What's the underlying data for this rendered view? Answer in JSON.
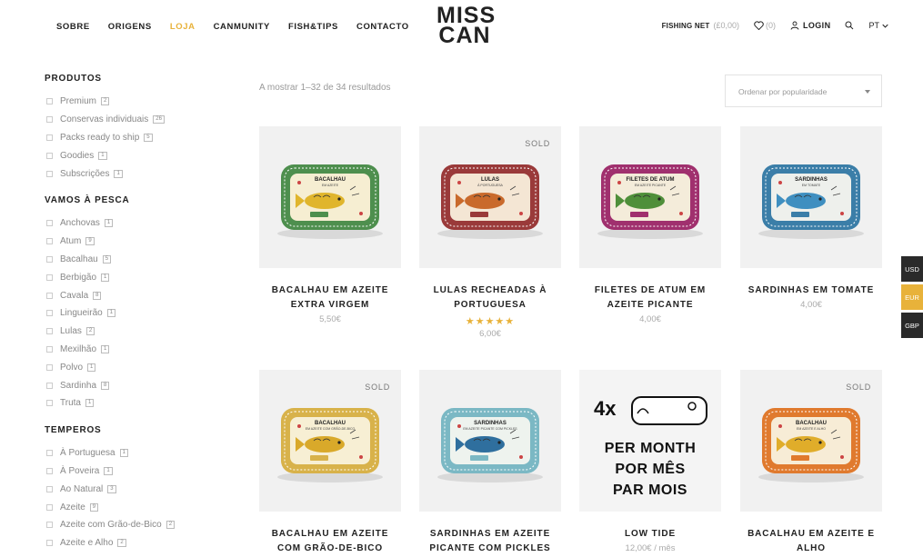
{
  "nav": {
    "items": [
      {
        "label": "SOBRE"
      },
      {
        "label": "ORIGENS"
      },
      {
        "label": "LOJA"
      },
      {
        "label": "CANMUNITY"
      },
      {
        "label": "FISH&TIPS"
      },
      {
        "label": "CONTACTO"
      }
    ],
    "active_index": 2,
    "active_color": "#e8b23a"
  },
  "logo": {
    "line1": "MISS",
    "line2": "CAN"
  },
  "header_right": {
    "fishing_net_label": "FISHING NET",
    "fishing_net_total": "(£0,00)",
    "wishlist_count": "(0)",
    "login_label": "LOGIN",
    "language": "PT"
  },
  "sidebar": {
    "sections": [
      {
        "title": "PRODUTOS",
        "items": [
          {
            "label": "Premium",
            "count": "2"
          },
          {
            "label": "Conservas individuais",
            "count": "26"
          },
          {
            "label": "Packs ready to ship",
            "count": "5"
          },
          {
            "label": "Goodies",
            "count": "1"
          },
          {
            "label": "Subscrições",
            "count": "1"
          }
        ]
      },
      {
        "title": "VAMOS À PESCA",
        "items": [
          {
            "label": "Anchovas",
            "count": "1"
          },
          {
            "label": "Atum",
            "count": "9"
          },
          {
            "label": "Bacalhau",
            "count": "5"
          },
          {
            "label": "Berbigão",
            "count": "1"
          },
          {
            "label": "Cavala",
            "count": "8"
          },
          {
            "label": "Lingueirão",
            "count": "1"
          },
          {
            "label": "Lulas",
            "count": "2"
          },
          {
            "label": "Mexilhão",
            "count": "1"
          },
          {
            "label": "Polvo",
            "count": "1"
          },
          {
            "label": "Sardinha",
            "count": "8"
          },
          {
            "label": "Truta",
            "count": "1"
          }
        ]
      },
      {
        "title": "TEMPEROS",
        "items": [
          {
            "label": "À Portuguesa",
            "count": "1"
          },
          {
            "label": "À Poveira",
            "count": "1"
          },
          {
            "label": "Ao Natural",
            "count": "3"
          },
          {
            "label": "Azeite",
            "count": "9"
          },
          {
            "label": "Azeite com Grão-de-Bico",
            "count": "2"
          },
          {
            "label": "Azeite e Alho",
            "count": "2"
          }
        ]
      }
    ]
  },
  "shop": {
    "result_count": "A mostrar 1–32 de 34 resultados",
    "sort_label": "Ordenar por popularidade"
  },
  "products": [
    {
      "name": "BACALHAU EM AZEITE EXTRA VIRGEM",
      "price": "5,50€",
      "sold": "",
      "rating": 0,
      "tin": {
        "title": "BACALHAU",
        "sub": "EM AZEITE",
        "border": "#4e8f4e",
        "panel": "#f6eed2",
        "fish": "#e0b52c"
      }
    },
    {
      "name": "LULAS RECHEADAS À PORTUGUESA",
      "price": "6,00€",
      "sold": "SOLD",
      "rating": 5,
      "tin": {
        "title": "LULAS",
        "sub": "À PORTUGUESA",
        "border": "#9a3a3a",
        "panel": "#f4e6d4",
        "fish": "#c96a2c"
      }
    },
    {
      "name": "FILETES DE ATUM EM AZEITE PICANTE",
      "price": "4,00€",
      "sold": "",
      "rating": 0,
      "tin": {
        "title": "FILETES DE ATUM",
        "sub": "EM AZEITE PICANTE",
        "border": "#a0306e",
        "panel": "#f4ecda",
        "fish": "#4f8f3a"
      }
    },
    {
      "name": "SARDINHAS EM TOMATE",
      "price": "4,00€",
      "sold": "",
      "rating": 0,
      "tin": {
        "title": "SARDINHAS",
        "sub": "EM TOMATE",
        "border": "#3b7ea8",
        "panel": "#eef0ec",
        "fish": "#3f8fc0"
      }
    },
    {
      "name": "BACALHAU EM AZEITE COM GRÃO-DE-BICO",
      "price": "",
      "sold": "SOLD",
      "rating": 0,
      "tin": {
        "title": "BACALHAU",
        "sub": "EM AZEITE COM GRÃO-DE-BICO",
        "border": "#d8b24a",
        "panel": "#f7efd4",
        "fish": "#d9a92a"
      }
    },
    {
      "name": "SARDINHAS EM AZEITE PICANTE COM PICKLES",
      "price": "",
      "sold": "",
      "rating": 0,
      "tin": {
        "title": "SARDINHAS",
        "sub": "EM AZEITE PICANTE COM PICKLES",
        "border": "#7bb8c4",
        "panel": "#eef3ee",
        "fish": "#2f6f9e"
      }
    },
    {
      "name": "LOW TIDE",
      "price": "12,00€ / mês",
      "sold": "",
      "rating": 0,
      "promo": {
        "mult": "4x",
        "lines": [
          "PER MONTH",
          "POR MÊS",
          "PAR MOIS"
        ]
      }
    },
    {
      "name": "BACALHAU EM AZEITE E ALHO",
      "price": "",
      "sold": "SOLD",
      "rating": 0,
      "tin": {
        "title": "BACALHAU",
        "sub": "EM AZEITE E ALHO",
        "border": "#e07a2e",
        "panel": "#f7ecd6",
        "fish": "#e0ad2a"
      }
    }
  ],
  "currency": [
    {
      "code": "USD",
      "color": "#2a2a2a"
    },
    {
      "code": "EUR",
      "color": "#e8b23a"
    },
    {
      "code": "GBP",
      "color": "#2a2a2a"
    }
  ],
  "icons": {
    "wishlist": "heart-icon",
    "login": "user-icon",
    "search": "search-icon",
    "language": "chevron-down-icon",
    "sort": "caret-down-icon"
  }
}
